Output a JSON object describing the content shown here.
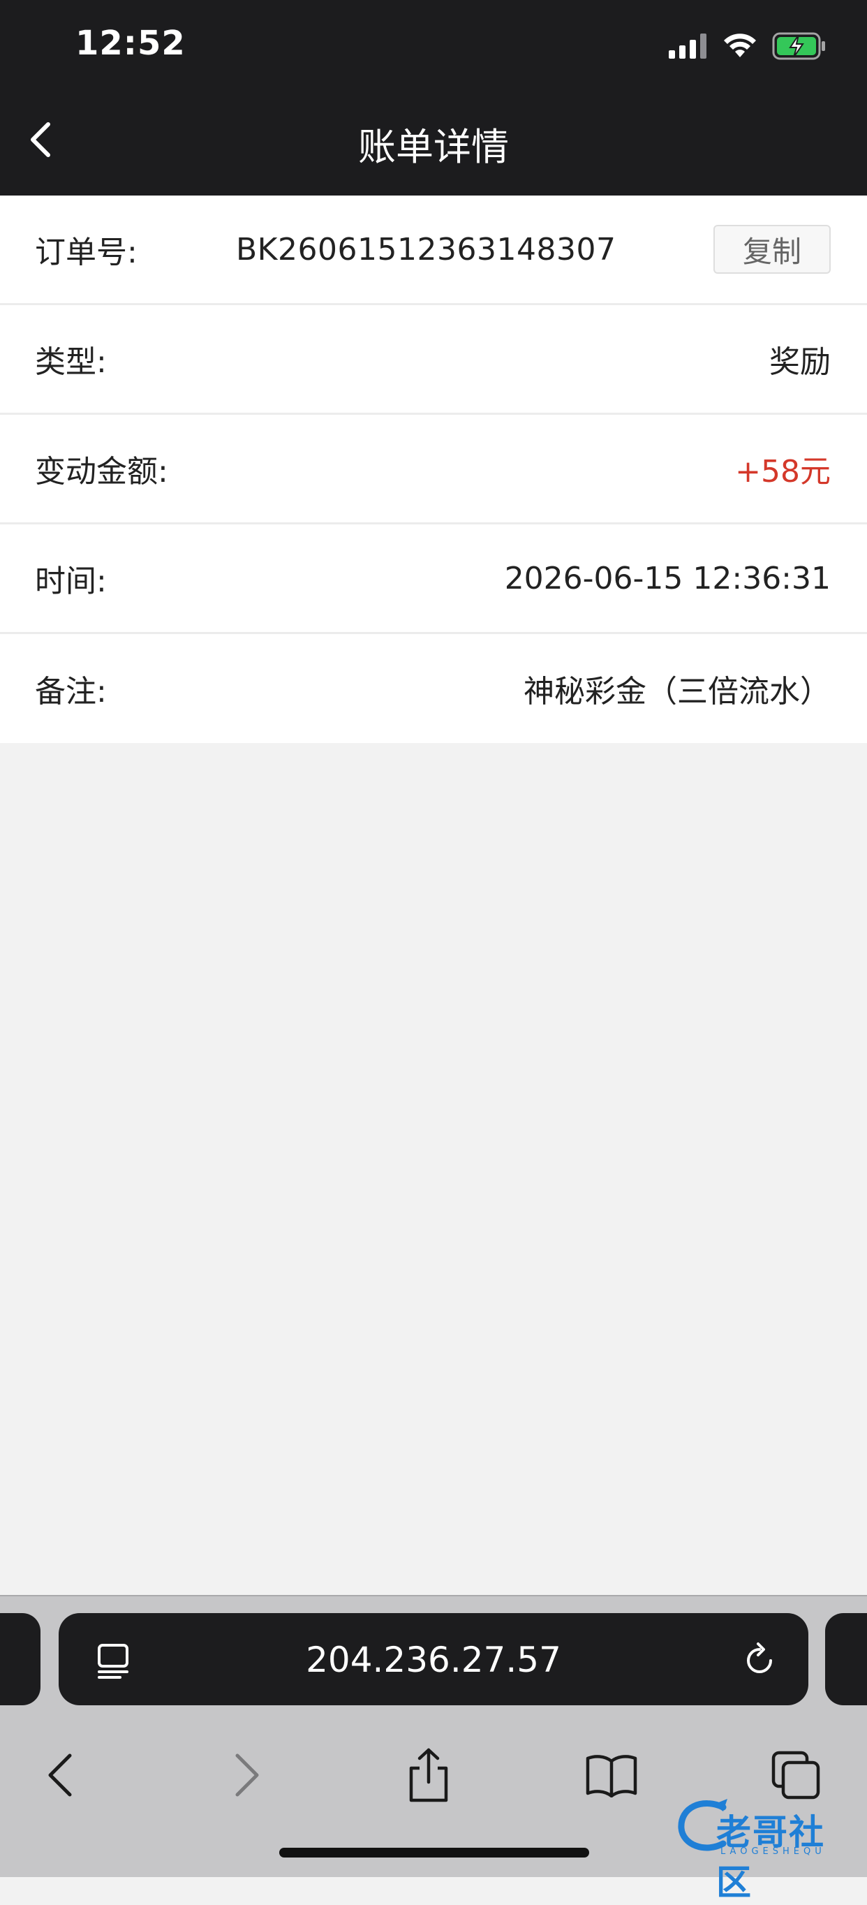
{
  "status_bar": {
    "time": "12:52"
  },
  "nav": {
    "title": "账单详情"
  },
  "details": {
    "order": {
      "label": "订单号:",
      "value": "BK26061512363148307",
      "copy_label": "复制"
    },
    "type": {
      "label": "类型:",
      "value": "奖励"
    },
    "amount": {
      "label": "变动金额:",
      "value": "+58元"
    },
    "time": {
      "label": "时间:",
      "value": "2026-06-15 12:36:31"
    },
    "remark": {
      "label": "备注:",
      "value": "神秘彩金（三倍流水）"
    }
  },
  "browser": {
    "url": "204.236.27.57"
  },
  "watermark": {
    "text": "老哥社区",
    "sub": "LAOGESHEQU"
  },
  "colors": {
    "accent_red": "#d4382a",
    "header_bg": "#1c1c1e",
    "battery_green": "#34c759"
  }
}
